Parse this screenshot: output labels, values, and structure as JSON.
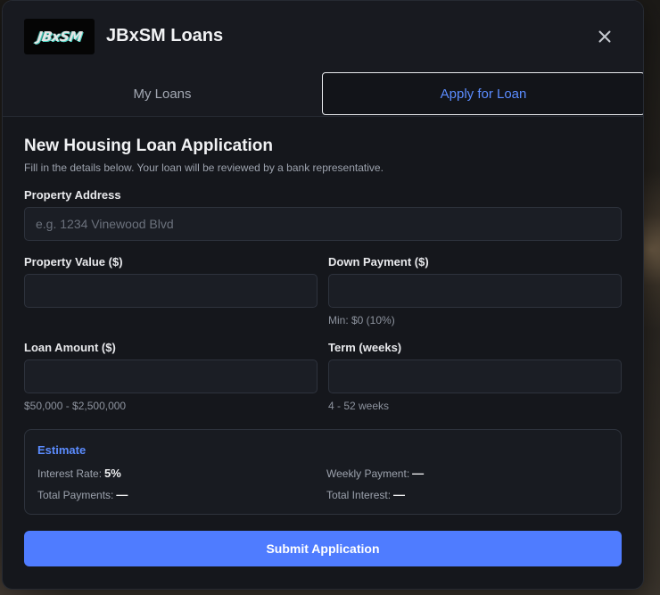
{
  "app": {
    "title": "JBxSM Loans",
    "logo_text": "JBxSM"
  },
  "tabs": [
    {
      "label": "My Loans",
      "active": false
    },
    {
      "label": "Apply for Loan",
      "active": true
    }
  ],
  "form": {
    "title": "New Housing Loan Application",
    "subtitle": "Fill in the details below. Your loan will be reviewed by a bank representative.",
    "property_address": {
      "label": "Property Address",
      "value": "",
      "placeholder": "e.g. 1234 Vinewood Blvd"
    },
    "property_value": {
      "label": "Property Value ($)",
      "value": ""
    },
    "down_payment": {
      "label": "Down Payment ($)",
      "value": "",
      "hint": "Min: $0 (10%)"
    },
    "loan_amount": {
      "label": "Loan Amount ($)",
      "value": "",
      "hint": "$50,000 - $2,500,000"
    },
    "term": {
      "label": "Term (weeks)",
      "value": "",
      "hint": "4 - 52 weeks"
    },
    "submit_label": "Submit Application"
  },
  "estimate": {
    "title": "Estimate",
    "interest_rate_label": "Interest Rate:",
    "interest_rate_value": "5%",
    "weekly_payment_label": "Weekly Payment:",
    "weekly_payment_value": "—",
    "total_payments_label": "Total Payments:",
    "total_payments_value": "—",
    "total_interest_label": "Total Interest:",
    "total_interest_value": "—"
  },
  "colors": {
    "accent": "#5b8cff",
    "button": "#4f7cff",
    "panel": "#15171c"
  },
  "icons": {
    "close": "close-icon"
  }
}
